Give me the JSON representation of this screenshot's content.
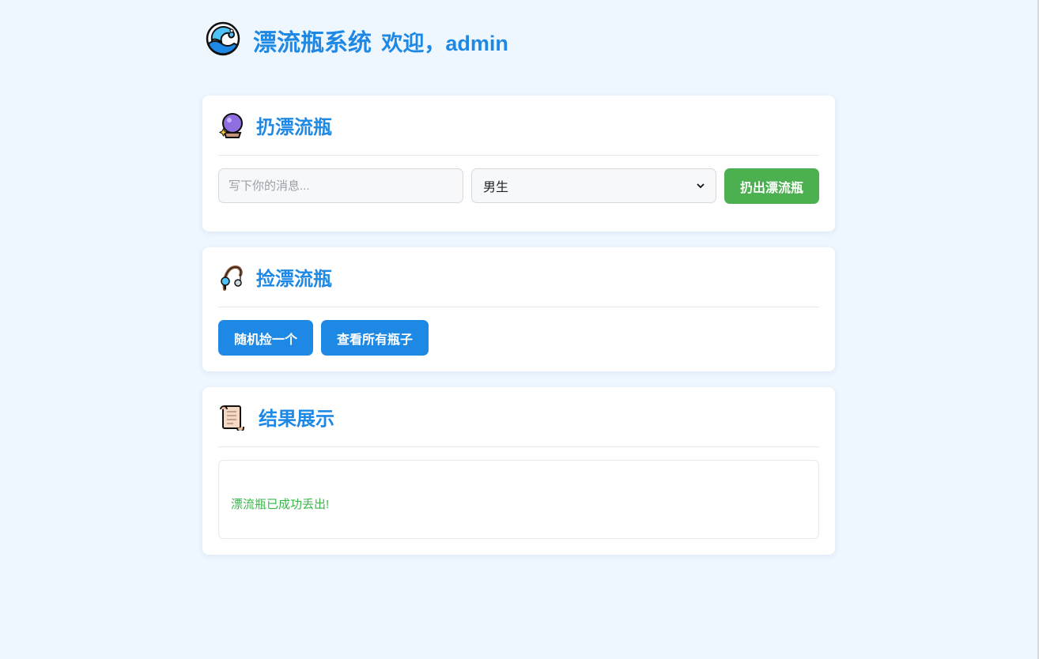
{
  "header": {
    "title": "漂流瓶系统",
    "welcome": "欢迎，admin",
    "icon": "wave-icon"
  },
  "throw_section": {
    "title": "扔漂流瓶",
    "icon": "crystal-ball-icon",
    "message_placeholder": "写下你的消息...",
    "gender_selected": "男生",
    "throw_button": "扔出漂流瓶"
  },
  "pick_section": {
    "title": "捡漂流瓶",
    "icon": "fishing-pole-icon",
    "random_button": "随机捡一个",
    "view_all_button": "查看所有瓶子"
  },
  "result_section": {
    "title": "结果展示",
    "icon": "scroll-icon",
    "message": "漂流瓶已成功丢出!"
  },
  "colors": {
    "page_bg": "#eef6fe",
    "accent_blue": "#1e88e5",
    "accent_green": "#4caf50",
    "success_text": "#3bb54a"
  }
}
